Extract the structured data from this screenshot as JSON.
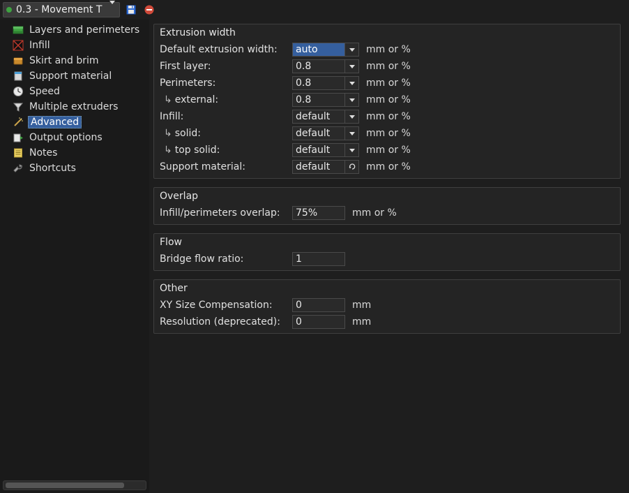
{
  "topbar": {
    "preset_label": "0.3 - Movement T"
  },
  "sidebar": {
    "items": [
      {
        "id": "layers-perimeters",
        "label": "Layers and perimeters",
        "icon": "layers"
      },
      {
        "id": "infill",
        "label": "Infill",
        "icon": "infill"
      },
      {
        "id": "skirt-brim",
        "label": "Skirt and brim",
        "icon": "skirt"
      },
      {
        "id": "support",
        "label": "Support material",
        "icon": "support"
      },
      {
        "id": "speed",
        "label": "Speed",
        "icon": "speed"
      },
      {
        "id": "multi-extruders",
        "label": "Multiple extruders",
        "icon": "funnel"
      },
      {
        "id": "advanced",
        "label": "Advanced",
        "icon": "wand",
        "selected": true
      },
      {
        "id": "output",
        "label": "Output options",
        "icon": "output"
      },
      {
        "id": "notes",
        "label": "Notes",
        "icon": "notes"
      },
      {
        "id": "shortcuts",
        "label": "Shortcuts",
        "icon": "wrench"
      }
    ]
  },
  "content": {
    "groups": [
      {
        "id": "extrusion-width",
        "title": "Extrusion width",
        "rows": [
          {
            "id": "default-extrusion-width",
            "label": "Default extrusion width:",
            "value": "auto",
            "selected": true,
            "dropdown": true,
            "unit": "mm or %"
          },
          {
            "id": "first-layer",
            "label": "First layer:",
            "value": "0.8",
            "dropdown": true,
            "unit": "mm or %"
          },
          {
            "id": "perimeters",
            "label": "Perimeters:",
            "value": "0.8",
            "dropdown": true,
            "unit": "mm or %"
          },
          {
            "id": "external-perimeters",
            "label": "external:",
            "sub": true,
            "value": "0.8",
            "dropdown": true,
            "unit": "mm or %"
          },
          {
            "id": "infill-width",
            "label": "Infill:",
            "value": "default",
            "dropdown": true,
            "unit": "mm or %"
          },
          {
            "id": "solid-infill",
            "label": "solid:",
            "sub": true,
            "value": "default",
            "dropdown": true,
            "unit": "mm or %"
          },
          {
            "id": "top-solid",
            "label": "top solid:",
            "sub": true,
            "value": "default",
            "dropdown": true,
            "unit": "mm or %"
          },
          {
            "id": "support-width",
            "label": "Support material:",
            "value": "default",
            "dropdown": true,
            "reset": true,
            "unit": "mm or %"
          }
        ]
      },
      {
        "id": "overlap",
        "title": "Overlap",
        "rows": [
          {
            "id": "infill-perim-overlap",
            "label": "Infill/perimeters overlap:",
            "value": "75%",
            "unit": "mm or %"
          }
        ]
      },
      {
        "id": "flow",
        "title": "Flow",
        "rows": [
          {
            "id": "bridge-flow",
            "label": "Bridge flow ratio:",
            "value": "1"
          }
        ]
      },
      {
        "id": "other",
        "title": "Other",
        "rows": [
          {
            "id": "xy-comp",
            "label": "XY Size Compensation:",
            "value": "0",
            "unit": "mm"
          },
          {
            "id": "resolution",
            "label": "Resolution (deprecated):",
            "value": "0",
            "unit": "mm"
          }
        ]
      }
    ]
  }
}
